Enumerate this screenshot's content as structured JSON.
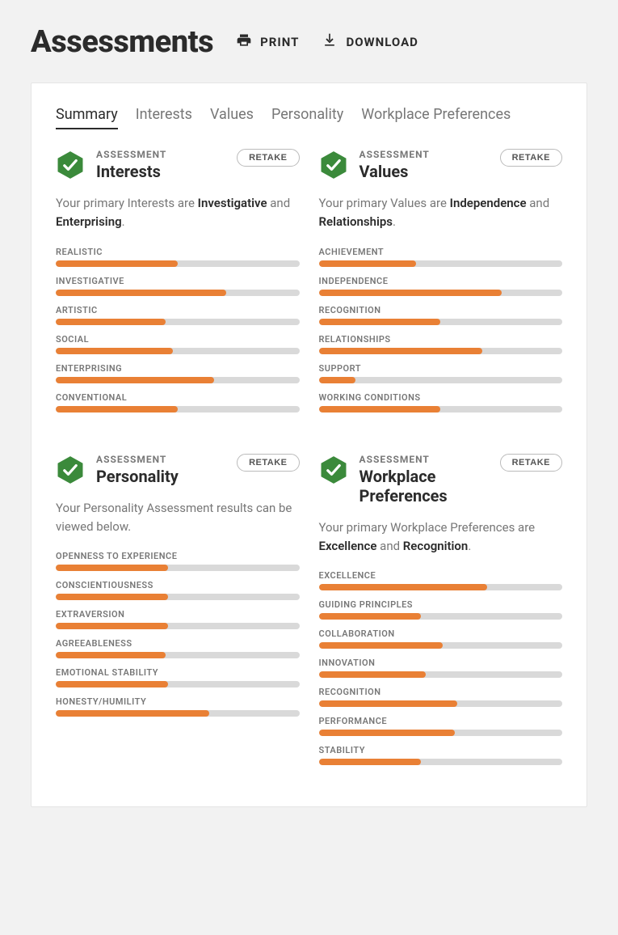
{
  "header": {
    "title": "Assessments",
    "print": "PRINT",
    "download": "DOWNLOAD"
  },
  "tabs": [
    "Summary",
    "Interests",
    "Values",
    "Personality",
    "Workplace Preferences"
  ],
  "labels": {
    "eyebrow": "ASSESSMENT",
    "retake": "RETAKE"
  },
  "cards": {
    "interests": {
      "title": "Interests",
      "desc_pre": "Your primary Interests are ",
      "desc_b1": "Investigative",
      "desc_mid": " and ",
      "desc_b2": "Enterprising",
      "desc_post": ".",
      "bars": [
        {
          "label": "REALISTIC",
          "pct": 50
        },
        {
          "label": "INVESTIGATIVE",
          "pct": 70
        },
        {
          "label": "ARTISTIC",
          "pct": 45
        },
        {
          "label": "SOCIAL",
          "pct": 48
        },
        {
          "label": "ENTERPRISING",
          "pct": 65
        },
        {
          "label": "CONVENTIONAL",
          "pct": 50
        }
      ]
    },
    "values": {
      "title": "Values",
      "desc_pre": "Your primary Values are ",
      "desc_b1": "Independence",
      "desc_mid": " and ",
      "desc_b2": "Relationships",
      "desc_post": ".",
      "bars": [
        {
          "label": "ACHIEVEMENT",
          "pct": 40
        },
        {
          "label": "INDEPENDENCE",
          "pct": 75
        },
        {
          "label": "RECOGNITION",
          "pct": 50
        },
        {
          "label": "RELATIONSHIPS",
          "pct": 67
        },
        {
          "label": "SUPPORT",
          "pct": 15
        },
        {
          "label": "WORKING CONDITIONS",
          "pct": 50
        }
      ]
    },
    "personality": {
      "title": "Personality",
      "desc_pre": "Your Personality Assessment results can be viewed below.",
      "bars": [
        {
          "label": "OPENNESS TO EXPERIENCE",
          "pct": 46
        },
        {
          "label": "CONSCIENTIOUSNESS",
          "pct": 46
        },
        {
          "label": "EXTRAVERSION",
          "pct": 46
        },
        {
          "label": "AGREEABLENESS",
          "pct": 45
        },
        {
          "label": "EMOTIONAL STABILITY",
          "pct": 46
        },
        {
          "label": "HONESTY/HUMILITY",
          "pct": 63
        }
      ]
    },
    "workplace": {
      "title": "Workplace Preferences",
      "desc_pre": "Your primary Workplace Preferences are ",
      "desc_b1": "Excellence",
      "desc_mid": " and ",
      "desc_b2": "Recognition",
      "desc_post": ".",
      "bars": [
        {
          "label": "EXCELLENCE",
          "pct": 69
        },
        {
          "label": "GUIDING PRINCIPLES",
          "pct": 42
        },
        {
          "label": "COLLABORATION",
          "pct": 51
        },
        {
          "label": "INNOVATION",
          "pct": 44
        },
        {
          "label": "RECOGNITION",
          "pct": 57
        },
        {
          "label": "PERFORMANCE",
          "pct": 56
        },
        {
          "label": "STABILITY",
          "pct": 42
        }
      ]
    }
  }
}
